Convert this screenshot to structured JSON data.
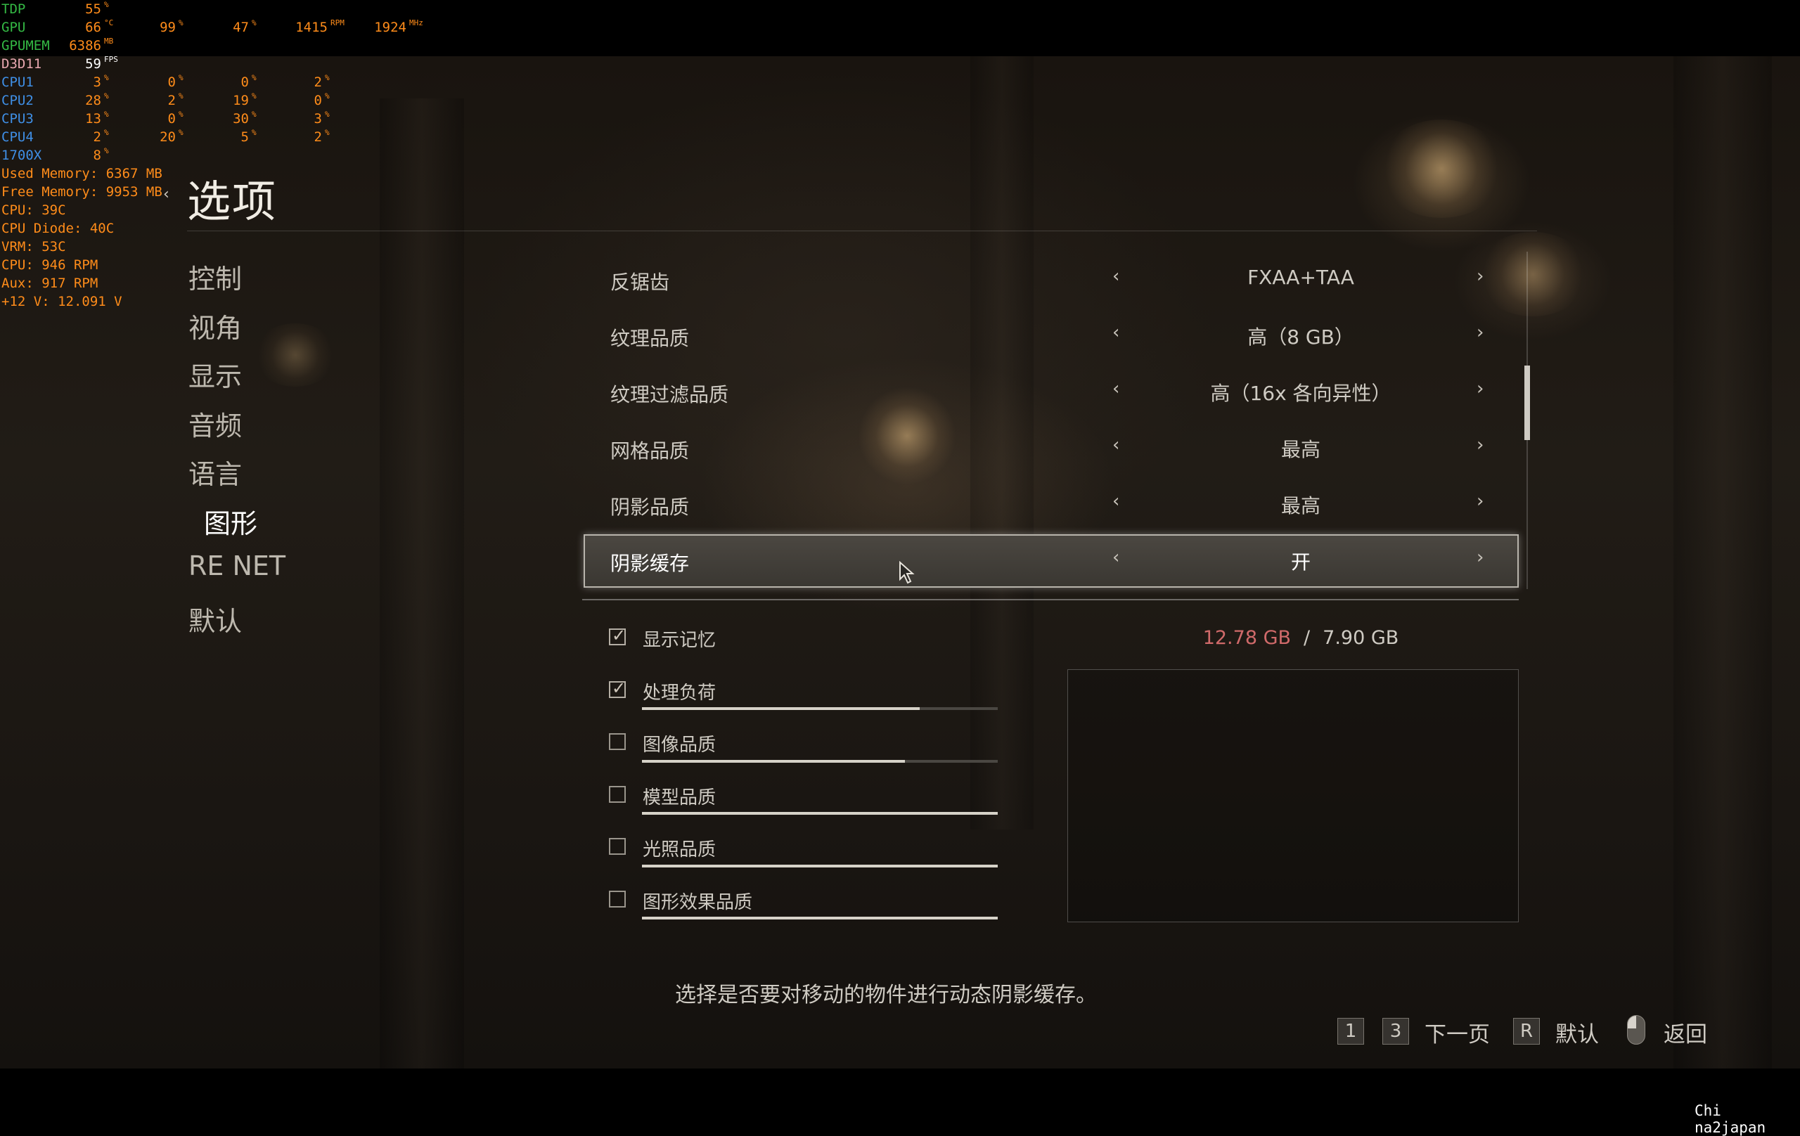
{
  "hud": {
    "rows": [
      {
        "label": "TDP",
        "color": "green",
        "vals": [
          {
            "v": "55",
            "u": "%",
            "c": "orange"
          }
        ]
      },
      {
        "label": "GPU",
        "color": "green",
        "vals": [
          {
            "v": "66",
            "u": "°C",
            "c": "orange"
          },
          {
            "v": "99",
            "u": "%",
            "c": "orange"
          },
          {
            "v": "47",
            "u": "%",
            "c": "orange"
          },
          {
            "v": "1415",
            "u": "RPM",
            "c": "orange"
          },
          {
            "v": "1924",
            "u": "MHz",
            "c": "orange"
          }
        ]
      },
      {
        "label": "GPUMEM",
        "color": "green",
        "vals": [
          {
            "v": "6386",
            "u": "MB",
            "c": "orange"
          }
        ]
      },
      {
        "label": "D3D11",
        "color": "pink",
        "vals": [
          {
            "v": "59",
            "u": "FPS",
            "c": "white"
          }
        ]
      },
      {
        "label": "CPU1",
        "color": "blue",
        "vals": [
          {
            "v": "3",
            "u": "%",
            "c": "orange"
          },
          {
            "v": "0",
            "u": "%",
            "c": "orange"
          },
          {
            "v": "0",
            "u": "%",
            "c": "orange"
          },
          {
            "v": "2",
            "u": "%",
            "c": "orange"
          }
        ]
      },
      {
        "label": "CPU2",
        "color": "blue",
        "vals": [
          {
            "v": "28",
            "u": "%",
            "c": "orange"
          },
          {
            "v": "2",
            "u": "%",
            "c": "orange"
          },
          {
            "v": "19",
            "u": "%",
            "c": "orange"
          },
          {
            "v": "0",
            "u": "%",
            "c": "orange"
          }
        ]
      },
      {
        "label": "CPU3",
        "color": "blue",
        "vals": [
          {
            "v": "13",
            "u": "%",
            "c": "orange"
          },
          {
            "v": "0",
            "u": "%",
            "c": "orange"
          },
          {
            "v": "30",
            "u": "%",
            "c": "orange"
          },
          {
            "v": "3",
            "u": "%",
            "c": "orange"
          }
        ]
      },
      {
        "label": "CPU4",
        "color": "blue",
        "vals": [
          {
            "v": "2",
            "u": "%",
            "c": "orange"
          },
          {
            "v": "20",
            "u": "%",
            "c": "orange"
          },
          {
            "v": "5",
            "u": "%",
            "c": "orange"
          },
          {
            "v": "2",
            "u": "%",
            "c": "orange"
          }
        ]
      },
      {
        "label": "1700X",
        "color": "blue",
        "vals": [
          {
            "v": "8",
            "u": "%",
            "c": "orange"
          }
        ]
      }
    ],
    "lines": [
      "Used Memory: 6367 MB",
      "Free Memory: 9953 MB",
      "CPU: 39C",
      "CPU Diode: 40C",
      "VRM: 53C",
      "CPU: 946 RPM",
      "Aux: 917 RPM",
      "+12 V: 12.091 V"
    ]
  },
  "menu": {
    "title": "选项",
    "items": [
      {
        "label": "控制",
        "active": false
      },
      {
        "label": "视角",
        "active": false
      },
      {
        "label": "显示",
        "active": false
      },
      {
        "label": "音频",
        "active": false
      },
      {
        "label": "语言",
        "active": false
      },
      {
        "label": "图形",
        "active": true
      },
      {
        "label": "RE NET",
        "active": false
      },
      {
        "label": "默认",
        "active": false
      }
    ]
  },
  "settings": [
    {
      "label": "反锯齿",
      "value": "FXAA+TAA",
      "selected": false
    },
    {
      "label": "纹理品质",
      "value": "高（8 GB）",
      "selected": false
    },
    {
      "label": "纹理过滤品质",
      "value": "高（16x 各向异性）",
      "selected": false
    },
    {
      "label": "网格品质",
      "value": "最高",
      "selected": false
    },
    {
      "label": "阴影品质",
      "value": "最高",
      "selected": false
    },
    {
      "label": "阴影缓存",
      "value": "开",
      "selected": true
    }
  ],
  "arrows": {
    "left": "‹",
    "right": "›"
  },
  "memory": {
    "used": "12.78 GB",
    "separator": "/",
    "total": "7.90 GB",
    "items": [
      {
        "label": "显示记忆",
        "checked": true,
        "level": null
      },
      {
        "label": "处理负荷",
        "checked": true,
        "level": 0.78
      },
      {
        "label": "图像品质",
        "checked": false,
        "level": 0.74
      },
      {
        "label": "模型品质",
        "checked": false,
        "level": 1.0
      },
      {
        "label": "光照品质",
        "checked": false,
        "level": 1.0
      },
      {
        "label": "图形效果品质",
        "checked": false,
        "level": 1.0
      }
    ]
  },
  "description": "选择是否要对移动的物件进行动态阴影缓存。",
  "footer": {
    "keys": [
      {
        "key": "1"
      },
      {
        "key": "3",
        "label": "下一页"
      },
      {
        "key": "R",
        "label": "默认"
      }
    ],
    "back_label": "返回",
    "mouse_icon": "mouse-icon"
  },
  "watermark": "Chi na2japan",
  "colors": {
    "memory_over": "#d06a6a",
    "hud_green": "#34b844",
    "hud_orange": "#ff8c1a",
    "hud_blue": "#3f8fe6"
  }
}
